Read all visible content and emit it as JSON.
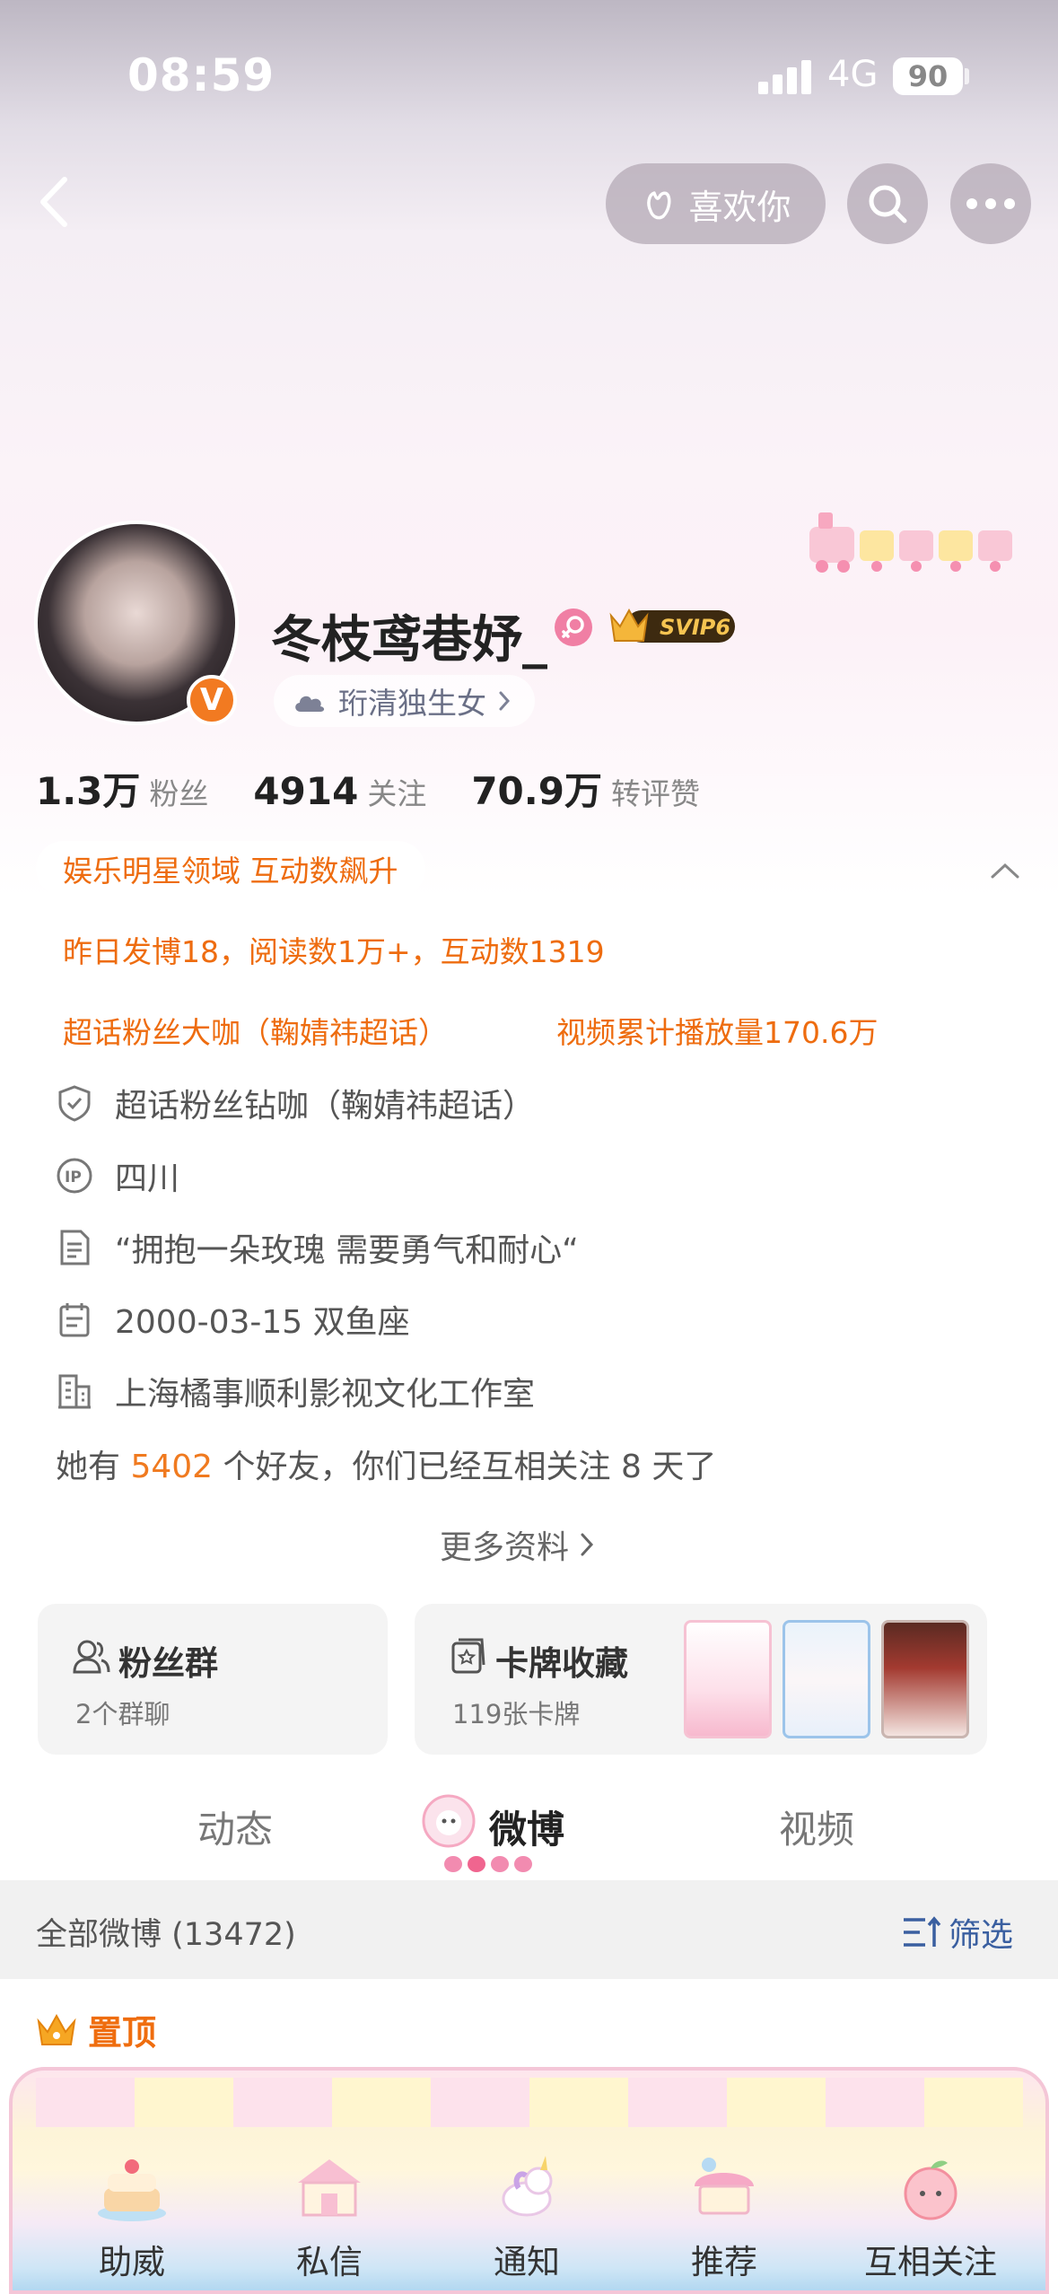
{
  "status_bar": {
    "time": "08:59",
    "network": "4G",
    "battery": "90"
  },
  "header": {
    "like_label": "喜欢你"
  },
  "profile": {
    "username": "冬枝鸢巷妤_",
    "svip_label": "SVIP6",
    "fan_tag": "珩清独生女",
    "verified_badge": "V"
  },
  "stats": [
    {
      "value": "1.3万",
      "label": "粉丝"
    },
    {
      "value": "4914",
      "label": "关注"
    },
    {
      "value": "70.9万",
      "label": "转评赞"
    }
  ],
  "highlights": {
    "domain": "娱乐明星领域 互动数飙升",
    "yesterday": "昨日发博18，阅读数1万+，互动数1319",
    "supertopic": "超话粉丝大咖（鞠婧祎超话）",
    "video": "视频累计播放量170.6万"
  },
  "info": {
    "supertopic_rank": "超话粉丝钻咖（鞠婧祎超话）",
    "ip_location": "四川",
    "bio": "“拥抱一朵玫瑰 需要勇气和耐心“",
    "birthday": "2000-03-15 双鱼座",
    "company": "上海橘事顺利影视文化工作室",
    "friends_prefix": "她有",
    "friends_count": "5402",
    "friends_suffix": "个好友，你们已经互相关注 8 天了",
    "more_label": "更多资料"
  },
  "cards": {
    "fan_group": {
      "title": "粉丝群",
      "sub": "2个群聊"
    },
    "card_collection": {
      "title": "卡牌收藏",
      "sub": "119张卡牌"
    }
  },
  "tabs": [
    "动态",
    "微博",
    "视频"
  ],
  "active_tab": "微博",
  "feed": {
    "all_label": "全部微博 (13472)",
    "filter_label": "筛选",
    "pinned_label": "置顶"
  },
  "bottom_nav": [
    "助威",
    "私信",
    "通知",
    "推荐",
    "互相关注"
  ],
  "colors": {
    "accent_orange": "#ee6c0f",
    "link_blue": "#3a5fa0",
    "verified_orange": "#f27a21"
  }
}
